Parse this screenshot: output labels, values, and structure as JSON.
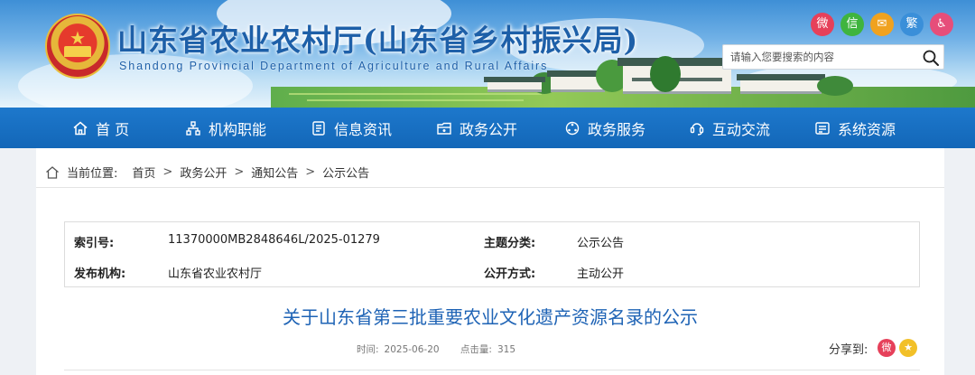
{
  "header": {
    "site_title": "山东省农业农村厅(山东省乡村振兴局)",
    "site_subtitle": "Shandong Provincial Department of Agriculture and Rural Affairs",
    "search_placeholder": "请输入您要搜索的内容",
    "share_icons": [
      {
        "name": "weibo-icon",
        "glyph": "微",
        "color": "#e6405a"
      },
      {
        "name": "wechat-icon",
        "glyph": "信",
        "color": "#3fb43e"
      },
      {
        "name": "email-icon",
        "glyph": "✉",
        "color": "#f0a21f"
      },
      {
        "name": "traditional-chinese-icon",
        "glyph": "繁",
        "color": "#3a8fd9"
      },
      {
        "name": "accessibility-icon",
        "glyph": "♿",
        "color": "#e64e7a"
      }
    ]
  },
  "nav": {
    "items": [
      {
        "label": "首 页",
        "icon": "home-icon"
      },
      {
        "label": "机构职能",
        "icon": "org-chart-icon"
      },
      {
        "label": "信息资讯",
        "icon": "document-icon"
      },
      {
        "label": "政务公开",
        "icon": "folder-icon"
      },
      {
        "label": "政务服务",
        "icon": "service-icon"
      },
      {
        "label": "互动交流",
        "icon": "interaction-icon"
      },
      {
        "label": "系统资源",
        "icon": "system-icon"
      }
    ]
  },
  "breadcrumb": {
    "label": "当前位置:",
    "items": [
      "首页",
      "政务公开",
      "通知公告",
      "公示公告"
    ],
    "separator": ">"
  },
  "meta": {
    "index_label": "索引号:",
    "index_value": "11370000MB2848646L/2025-01279",
    "category_label": "主题分类:",
    "category_value": "公示公告",
    "publisher_label": "发布机构:",
    "publisher_value": "山东省农业农村厅",
    "disclosure_label": "公开方式:",
    "disclosure_value": "主动公开"
  },
  "article": {
    "title": "关于山东省第三批重要农业文化遗产资源名录的公示",
    "time_label": "时间:",
    "time_value": "2025-06-20",
    "clicks_label": "点击量:",
    "clicks_value": "315",
    "share_label": "分享到:"
  },
  "colors": {
    "nav_bg": "#1367b8",
    "title_blue": "#1e63b5",
    "weibo_red": "#e6405a",
    "star_yellow": "#f2c028"
  }
}
